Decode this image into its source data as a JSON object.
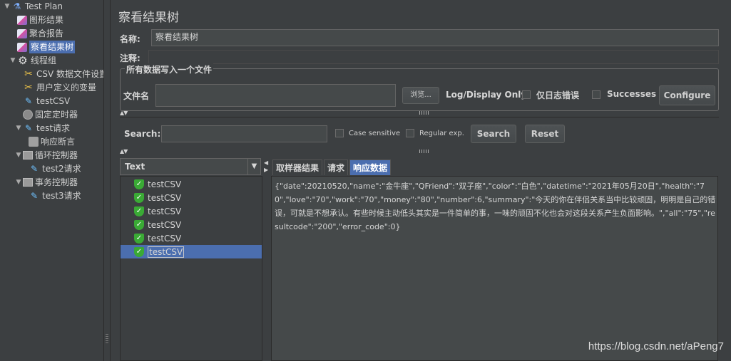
{
  "tree": {
    "items": [
      {
        "label": "Test Plan",
        "icon": "flask-icon",
        "toggle": "▼",
        "level": 0
      },
      {
        "label": "图形结果",
        "icon": "chart-icon",
        "toggle": "",
        "level": 1
      },
      {
        "label": "聚合报告",
        "icon": "chart-icon",
        "toggle": "",
        "level": 1
      },
      {
        "label": "察看结果树",
        "icon": "chart-icon",
        "toggle": "",
        "level": 1,
        "selected": true
      },
      {
        "label": "线程组",
        "icon": "gear-icon",
        "toggle": "▼",
        "level": 1
      },
      {
        "label": "CSV 数据文件设置",
        "icon": "tools-icon",
        "toggle": "",
        "level": 2
      },
      {
        "label": "用户定义的变量",
        "icon": "tools-icon",
        "toggle": "",
        "level": 2
      },
      {
        "label": "testCSV",
        "icon": "pen-icon",
        "toggle": "",
        "level": 2
      },
      {
        "label": "固定定时器",
        "icon": "clock-icon",
        "toggle": "",
        "level": 2
      },
      {
        "label": "test请求",
        "icon": "pen-icon",
        "toggle": "▼",
        "level": 2
      },
      {
        "label": "响应断言",
        "icon": "assert-icon",
        "toggle": "",
        "level": 3
      },
      {
        "label": "循环控制器",
        "icon": "box-icon",
        "toggle": "▼",
        "level": 2
      },
      {
        "label": "test2请求",
        "icon": "pen-icon",
        "toggle": "",
        "level": 3
      },
      {
        "label": "事务控制器",
        "icon": "box-icon",
        "toggle": "▼",
        "level": 2
      },
      {
        "label": "test3请求",
        "icon": "pen-icon",
        "toggle": "",
        "level": 3
      }
    ]
  },
  "panel": {
    "title": "察看结果树",
    "name_label": "名称:",
    "name_value": "察看结果树",
    "comment_label": "注释:",
    "comment_value": ""
  },
  "file_group": {
    "title": "所有数据写入一个文件",
    "filename_label": "文件名",
    "filename_value": "",
    "browse": "浏览...",
    "log_display_label": "Log/Display Only:",
    "errors_only": "仅日志错误",
    "successes": "Successes",
    "configure": "Configure"
  },
  "search": {
    "label": "Search:",
    "value": "",
    "case_sensitive": "Case sensitive",
    "regex": "Regular exp.",
    "search_button": "Search",
    "reset_button": "Reset"
  },
  "renderer": {
    "selected": "Text"
  },
  "results": [
    {
      "label": "testCSV",
      "status": "success"
    },
    {
      "label": "testCSV",
      "status": "success"
    },
    {
      "label": "testCSV",
      "status": "success"
    },
    {
      "label": "testCSV",
      "status": "success"
    },
    {
      "label": "testCSV",
      "status": "success"
    },
    {
      "label": "testCSV",
      "status": "success",
      "selected": true
    }
  ],
  "tabs": [
    "取样器结果",
    "请求",
    "响应数据"
  ],
  "active_tab": "响应数据",
  "response_data": "{\"date\":20210520,\"name\":\"金牛座\",\"QFriend\":\"双子座\",\"color\":\"白色\",\"datetime\":\"2021年05月20日\",\"health\":\"70\",\"love\":\"70\",\"work\":\"70\",\"money\":\"80\",\"number\":6,\"summary\":\"今天的你在伴侣关系当中比较顽固，明明是自己的错误，可就是不想承认。有些时候主动低头其实是一件简单的事，一味的顽固不化也会对这段关系产生负面影响。\",\"all\":\"75\",\"resultcode\":\"200\",\"error_code\":0}",
  "watermark": "https://blog.csdn.net/aPeng7",
  "colors": {
    "background": "#3c3f41",
    "selection": "#4b6eaf",
    "success": "#3aaa35"
  }
}
